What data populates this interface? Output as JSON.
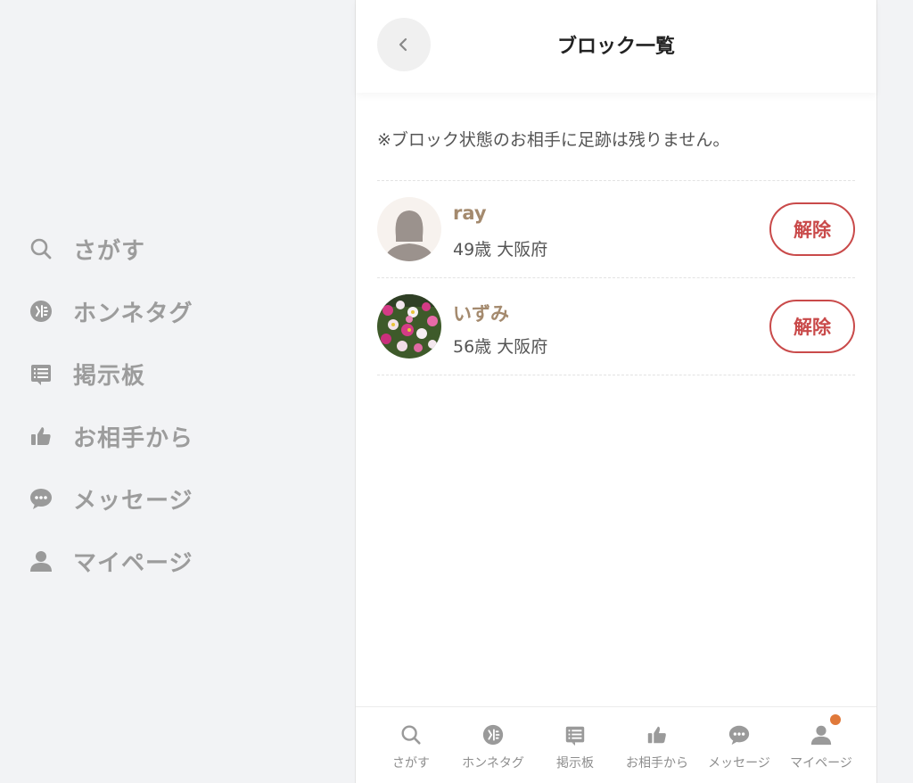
{
  "colors": {
    "accent_name": "#a48a6e",
    "unblock": "#c94a4a",
    "nav_gray": "#9c9c9c",
    "notification_dot": "#e0793a"
  },
  "side_nav": {
    "items": [
      {
        "label": "さがす",
        "icon": "search-icon"
      },
      {
        "label": "ホンネタグ",
        "icon": "tag-icon"
      },
      {
        "label": "掲示板",
        "icon": "board-icon"
      },
      {
        "label": "お相手から",
        "icon": "thumbs-up-icon"
      },
      {
        "label": "メッセージ",
        "icon": "chat-bubble-icon"
      },
      {
        "label": "マイページ",
        "icon": "person-icon"
      }
    ]
  },
  "header": {
    "title": "ブロック一覧",
    "back_icon": "chevron-left-icon"
  },
  "notice": "※ブロック状態のお相手に足跡は残りません。",
  "blocked_users": [
    {
      "name": "ray",
      "age": "49歳",
      "location": "大阪府",
      "button": "解除",
      "avatar": "default-avatar"
    },
    {
      "name": "いずみ",
      "age": "56歳",
      "location": "大阪府",
      "button": "解除",
      "avatar": "flower-photo"
    }
  ],
  "tabbar": {
    "items": [
      {
        "label": "さがす",
        "icon": "search-icon"
      },
      {
        "label": "ホンネタグ",
        "icon": "tag-icon"
      },
      {
        "label": "掲示板",
        "icon": "board-icon"
      },
      {
        "label": "お相手から",
        "icon": "thumbs-up-icon"
      },
      {
        "label": "メッセージ",
        "icon": "chat-bubble-icon"
      },
      {
        "label": "マイページ",
        "icon": "person-icon",
        "has_notification": true
      }
    ]
  }
}
